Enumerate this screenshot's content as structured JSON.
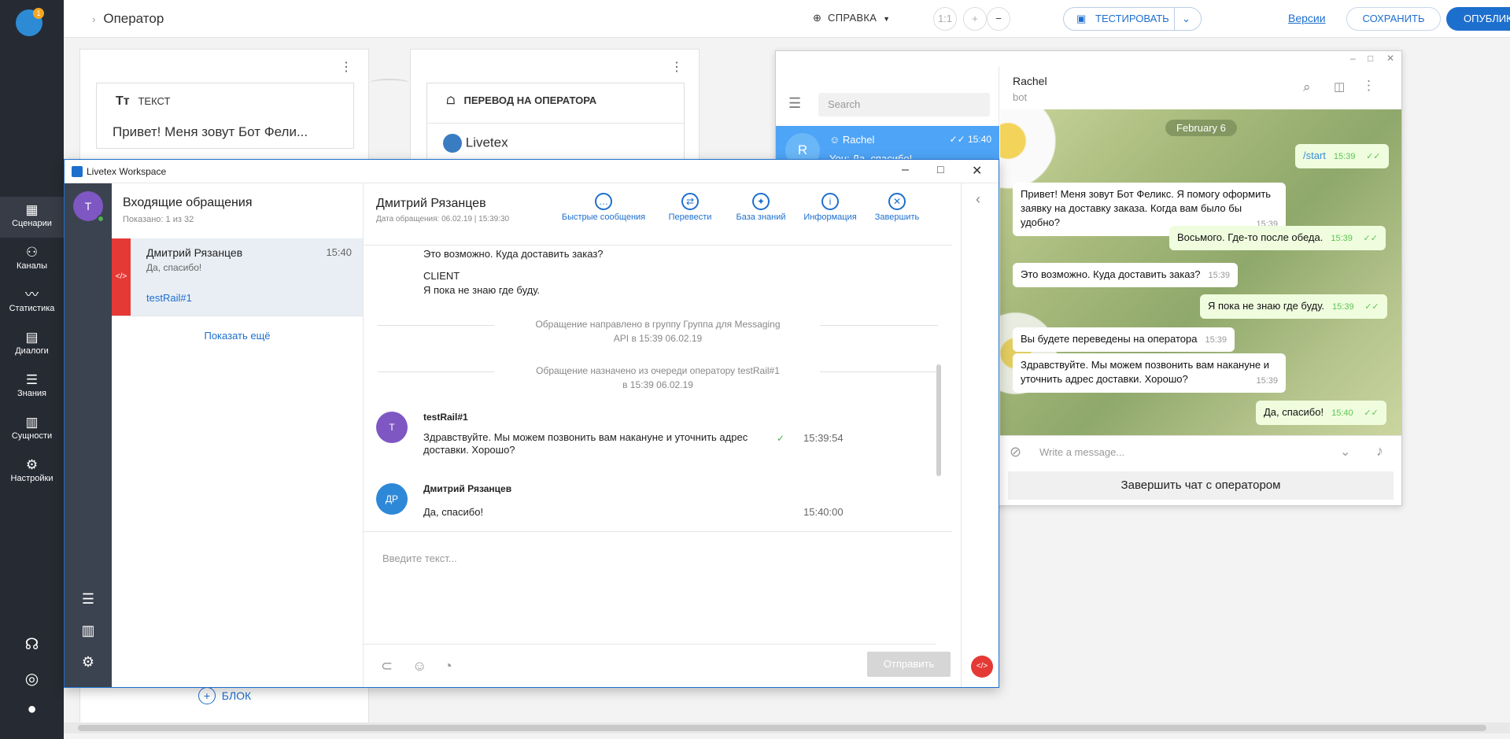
{
  "colors": {
    "accent": "#1d6fce",
    "nav_bg": "#262a33",
    "tg_selected": "#4ea4f6",
    "send_disabled": "#d6d6d6",
    "danger": "#e53935"
  },
  "appnav": {
    "logo_badge": "1",
    "items": [
      {
        "label": "Сценарии",
        "icon": "scenarios-icon"
      },
      {
        "label": "Каналы",
        "icon": "channels-icon"
      },
      {
        "label": "Статистика",
        "icon": "stats-icon"
      },
      {
        "label": "Диалоги",
        "icon": "dialogs-icon"
      },
      {
        "label": "Знания",
        "icon": "knowledge-icon"
      },
      {
        "label": "Сущности",
        "icon": "entities-icon"
      },
      {
        "label": "Настройки",
        "icon": "settings-icon"
      }
    ]
  },
  "topbar": {
    "breadcrumb": "Оператор",
    "help": "СПРАВКА",
    "zoom_reset": "1:1",
    "zoom_in": "+",
    "zoom_out": "−",
    "test": "ТЕСТИРОВАТЬ",
    "versions": "Версии",
    "save": "СОХРАНИТЬ",
    "publish": "ОПУБЛИКОВАТЬ"
  },
  "canvas": {
    "block1": {
      "type_label": "ТЕКСТ",
      "text": "Привет! Меня зовут Бот Фели..."
    },
    "block2": {
      "type_label": "ПЕРЕВОД НА ОПЕРАТОРА",
      "channel": "Livetex"
    },
    "add_block": "БЛОК"
  },
  "telegram": {
    "search_placeholder": "Search",
    "chat": {
      "avatar": "R",
      "name": "Rachel",
      "time": "15:40",
      "preview": "You: Да, спасибо!"
    },
    "header": {
      "name": "Rachel",
      "status": "bot"
    },
    "date": "February 6",
    "messages": [
      {
        "dir": "out",
        "text": "/start",
        "time": "15:39"
      },
      {
        "dir": "in",
        "text": "Привет! Меня зовут Бот Феликс. Я помогу оформить заявку на доставку заказа. Когда вам было бы удобно?",
        "time": "15:39"
      },
      {
        "dir": "out",
        "text": "Восьмого. Где-то после обеда.",
        "time": "15:39"
      },
      {
        "dir": "in",
        "text": "Это возможно. Куда доставить заказ?",
        "time": "15:39"
      },
      {
        "dir": "out",
        "text": "Я пока не знаю где буду.",
        "time": "15:39"
      },
      {
        "dir": "in",
        "text": "Вы будете переведены на оператора",
        "time": "15:39"
      },
      {
        "dir": "in",
        "text": "Здравствуйте. Мы можем позвонить вам накануне и уточнить адрес доставки. Хорошо?",
        "time": "15:39"
      },
      {
        "dir": "out",
        "text": "Да, спасибо!",
        "time": "15:40"
      }
    ],
    "input_placeholder": "Write a message...",
    "finish_button": "Завершить чат с оператором"
  },
  "workspace": {
    "title": "Livetex Workspace",
    "operator_avatar": "T",
    "list": {
      "title": "Входящие обращения",
      "shown": "Показано: 1 из 32",
      "item": {
        "name": "Дмитрий Рязанцев",
        "time": "15:40",
        "preview": "Да, спасибо!",
        "operator": "testRail#1",
        "badge": "</>"
      },
      "show_more": "Показать ещё"
    },
    "conv": {
      "client_name": "Дмитрий Рязанцев",
      "date": "Дата обращения: 06.02.19 | 15:39:30",
      "tools": [
        "Быстрые сообщения",
        "Перевести",
        "База знаний",
        "Информация",
        "Завершить"
      ],
      "prev_text": "Это возможно. Куда доставить заказ?",
      "client_label": "CLIENT",
      "client_text": "Я пока не знаю где буду.",
      "sys1_line1": "Обращение направлено в группу Группа для Messaging",
      "sys1_line2": "API в 15:39 06.02.19",
      "sys2_line1": "Обращение назначено из очереди оператору testRail#1",
      "sys2_line2": "в 15:39 06.02.19",
      "msg1": {
        "avatar": "T",
        "author": "testRail#1",
        "text": "Здравствуйте. Мы можем позвонить вам накануне и уточнить адрес доставки. Хорошо?",
        "time": "15:39:54"
      },
      "msg2": {
        "avatar": "ДР",
        "author": "Дмитрий Рязанцев",
        "text": "Да, спасибо!",
        "time": "15:40:00"
      },
      "input_placeholder": "Введите текст...",
      "send": "Отправить",
      "code_badge": "</>"
    }
  }
}
